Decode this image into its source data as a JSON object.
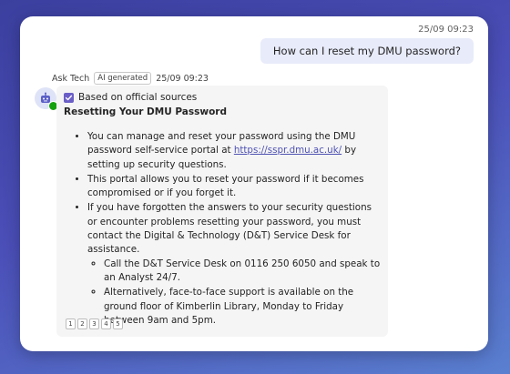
{
  "user_message": {
    "timestamp": "25/09 09:23",
    "text": "How can I reset my DMU password?"
  },
  "bot_message": {
    "sender": "Ask Tech",
    "badge": "AI generated",
    "timestamp": "25/09 09:23",
    "sources_label": "Based on official sources",
    "title": "Resetting Your DMU Password",
    "bullets": [
      {
        "before_link": "You can manage and reset your password using the DMU password self-service portal at ",
        "link": "https://sspr.dmu.ac.uk/",
        "after_link": " by setting up security questions."
      },
      {
        "text": "This portal allows you to reset your password if it becomes compromised or if you forget it."
      },
      {
        "text": "If you have forgotten the answers to your security questions or encounter problems resetting your password, you must contact the Digital & Technology (D&T) Service Desk for assistance."
      }
    ],
    "sub_bullets": [
      "Call the D&T Service Desk on 0116 250 6050 and speak to an Analyst 24/7.",
      "Alternatively, face-to-face support is available on the ground floor of Kimberlin Library, Monday to Friday between 9am and 5pm."
    ],
    "citations": [
      "1",
      "2",
      "3",
      "4",
      "5"
    ]
  },
  "colors": {
    "accent": "#6b5fc7",
    "link": "#4f52b2",
    "user_bubble": "#e8ebfa",
    "bot_bubble": "#f5f5f5",
    "status_online": "#13a10e"
  },
  "icons": {
    "avatar": "bot-icon",
    "sources": "checkbox-checked-icon",
    "status": "status-online-icon"
  }
}
